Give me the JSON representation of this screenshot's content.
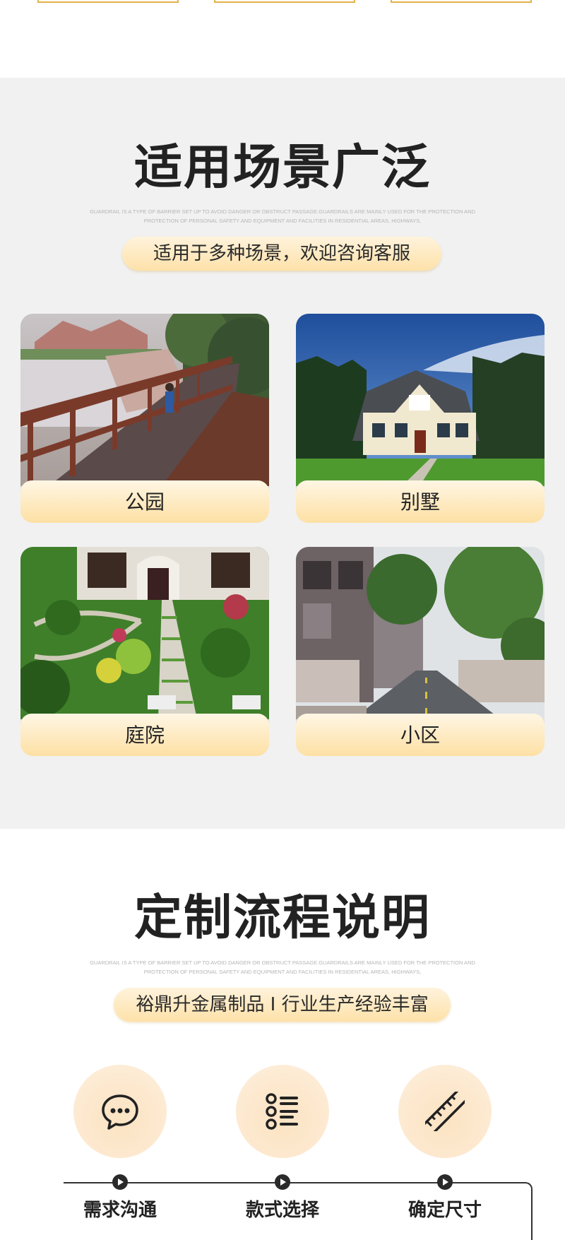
{
  "scenes": {
    "title": "适用场景广泛",
    "subtitle": "GUARDRAIL IS A TYPE OF BARRIER SET UP TO AVOID DANGER OR OBSTRUCT PASSAGE.GUARDRAILS ARE MAINLY USED FOR THE PROTECTION AND PROTECTION OF PERSONAL SAFETY AND EQUIPMENT AND FACILITIES IN RESIDENTIAL AREAS, HIGHWAYS,",
    "pill": "适用于多种场景，欢迎咨询客服",
    "cards": [
      {
        "label": "公园"
      },
      {
        "label": "别墅"
      },
      {
        "label": "庭院"
      },
      {
        "label": "小区"
      }
    ]
  },
  "process": {
    "title": "定制流程说明",
    "subtitle": "GUARDRAIL IS A TYPE OF BARRIER SET UP TO AVOID DANGER OR OBSTRUCT PASSAGE.GUARDRAILS ARE MAINLY USED FOR THE PROTECTION AND PROTECTION OF PERSONAL SAFETY AND EQUIPMENT AND FACILITIES IN RESIDENTIAL AREAS, HIGHWAYS,",
    "pill": "裕鼎升金属制品 I 行业生产经验丰富",
    "steps": [
      {
        "label": "需求沟通",
        "icon": "chat-bubble-icon"
      },
      {
        "label": "款式选择",
        "icon": "list-icon"
      },
      {
        "label": "确定尺寸",
        "icon": "ruler-icon"
      }
    ]
  },
  "colors": {
    "accent": "#fde1a9",
    "section_bg": "#f1f1f1",
    "text_dark": "#222222"
  }
}
